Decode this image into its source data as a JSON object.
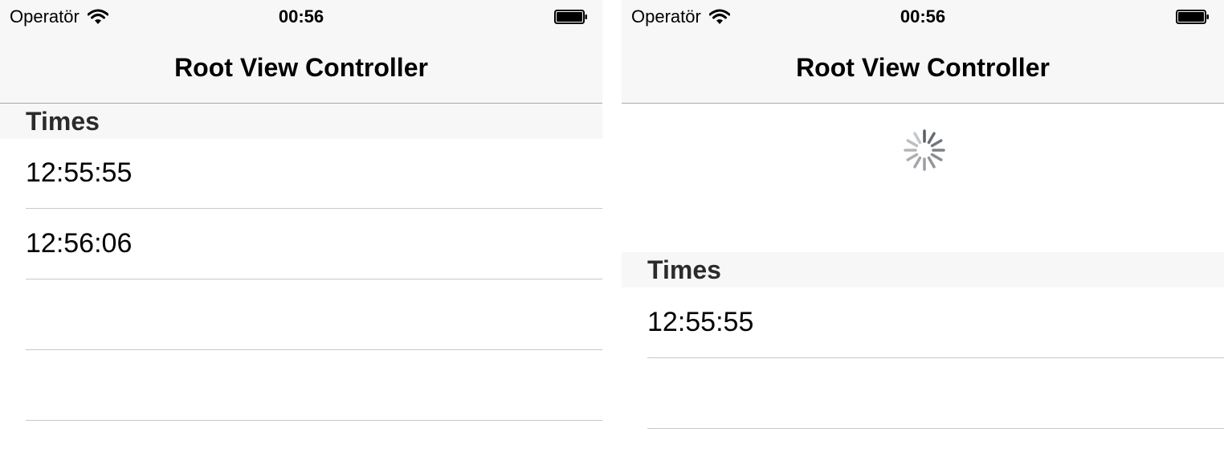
{
  "left": {
    "status": {
      "carrier": "Operatör",
      "time": "00:56"
    },
    "nav": {
      "title": "Root View Controller"
    },
    "section": {
      "header": "Times"
    },
    "rows": [
      "12:55:55",
      "12:56:06",
      "",
      ""
    ]
  },
  "right": {
    "status": {
      "carrier": "Operatör",
      "time": "00:56"
    },
    "nav": {
      "title": "Root View Controller"
    },
    "refresh": {
      "state": "loading",
      "icon": "activity-spinner-icon"
    },
    "section": {
      "header": "Times"
    },
    "rows": [
      "12:55:55",
      ""
    ]
  },
  "colors": {
    "bar_background": "#f7f7f7",
    "separator": "#c8c7cc",
    "spinner": "#5b5f66"
  }
}
